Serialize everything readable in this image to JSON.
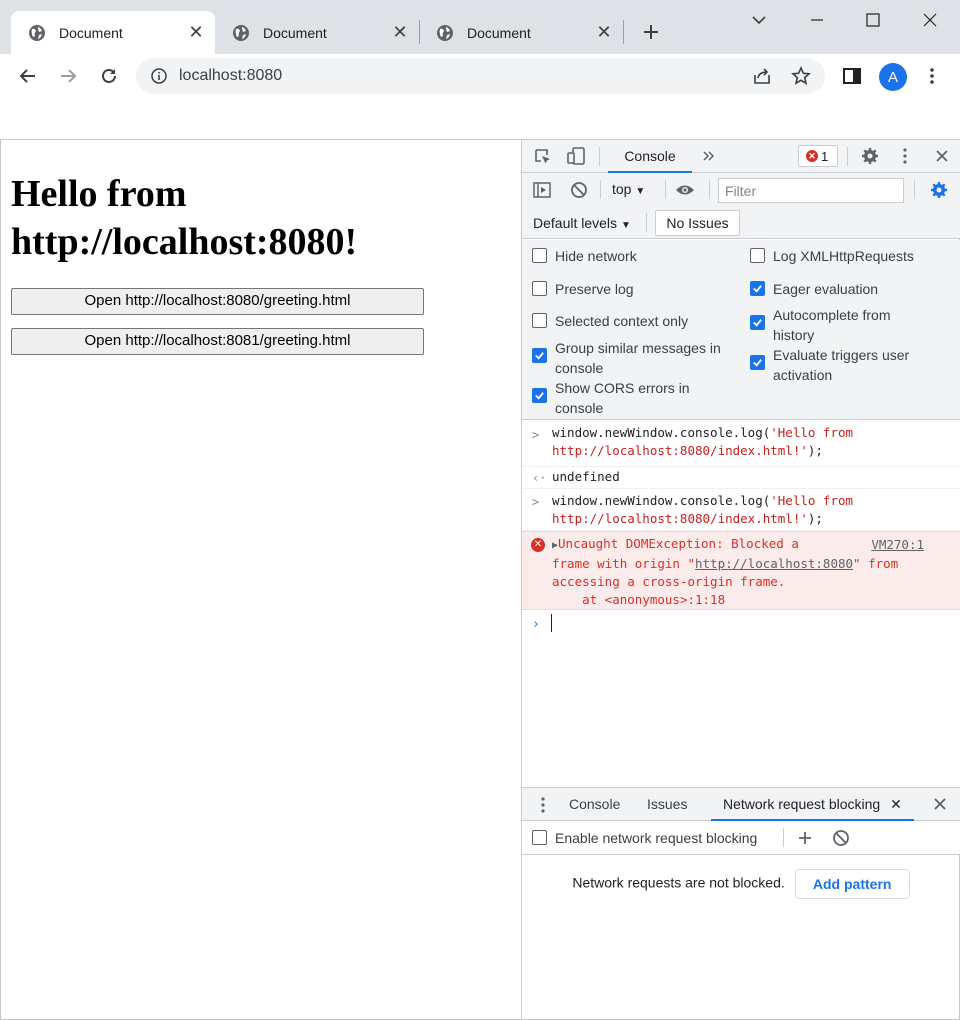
{
  "browser": {
    "tabs": [
      {
        "title": "Document",
        "active": true
      },
      {
        "title": "Document",
        "active": false
      },
      {
        "title": "Document",
        "active": false
      }
    ],
    "url": "localhost:8080",
    "profile_initial": "A"
  },
  "page": {
    "heading": "Hello from http://localhost:8080!",
    "buttons": [
      "Open http://localhost:8080/greeting.html",
      "Open http://localhost:8081/greeting.html"
    ]
  },
  "devtools": {
    "main_tab": "Console",
    "error_count": "1",
    "context": "top",
    "filter_placeholder": "Filter",
    "levels": "Default levels",
    "issues_button": "No Issues",
    "settings": {
      "left": [
        {
          "label": "Hide network",
          "checked": false
        },
        {
          "label": "Preserve log",
          "checked": false
        },
        {
          "label": "Selected context only",
          "checked": false
        },
        {
          "label": "Group similar messages in console",
          "checked": true
        },
        {
          "label": "Show CORS errors in console",
          "checked": true
        }
      ],
      "right": [
        {
          "label": "Log XMLHttpRequests",
          "checked": false
        },
        {
          "label": "Eager evaluation",
          "checked": true
        },
        {
          "label": "Autocomplete from history",
          "checked": true
        },
        {
          "label": "Evaluate triggers user activation",
          "checked": true
        }
      ]
    },
    "console": {
      "cmd1_prefix": "window.newWindow.console.log(",
      "cmd1_string": "'Hello from http://localhost:8080/index.html!'",
      "cmd1_suffix": ");",
      "result1": "undefined",
      "cmd2_prefix": "window.newWindow.console.log(",
      "cmd2_string": "'Hello from http://localhost:8080/index.html!'",
      "cmd2_suffix": ");",
      "error_head": "Uncaught DOMException: Blocked a",
      "error_line2a": "frame with origin \"",
      "error_origin": "http://localhost:8080",
      "error_line2b": "\" from",
      "error_line3": "accessing a cross-origin frame.",
      "error_line4": "    at <anonymous>:1:18",
      "error_source": "VM270:1"
    },
    "drawer": {
      "tabs": [
        "Console",
        "Issues",
        "Network request blocking"
      ],
      "enable_label": "Enable network request blocking",
      "empty_text": "Network requests are not blocked.",
      "add_pattern": "Add pattern"
    }
  },
  "colors": {
    "accent": "#1a73e8",
    "error": "#d93025",
    "string": "#c5221f"
  }
}
